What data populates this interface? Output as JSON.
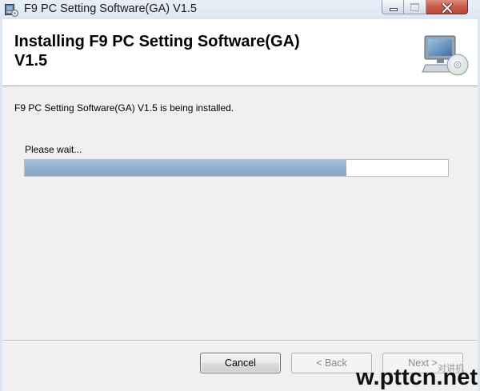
{
  "window": {
    "title": "F9 PC Setting Software(GA) V1.5",
    "icon": "installer-icon",
    "controls": {
      "minimize_icon": "minimize-icon",
      "maximize_icon": "maximize-icon",
      "close_icon": "close-icon",
      "maximize_enabled": false
    }
  },
  "header": {
    "title": "Installing F9 PC Setting Software(GA) V1.5",
    "icon": "computer-disc-icon"
  },
  "body": {
    "status_text": "F9 PC Setting Software(GA) V1.5 is being installed.",
    "wait_label": "Please wait...",
    "progress": 0.76
  },
  "buttons": {
    "cancel_label": "Cancel",
    "back_label": "< Back",
    "next_label": "Next >",
    "back_enabled": false,
    "next_enabled": false
  },
  "watermark": {
    "site": "w.pttcn.net",
    "caption": "对讲机"
  },
  "colors": {
    "progress_fill": "#8badcf",
    "close_button": "#c8503f"
  }
}
